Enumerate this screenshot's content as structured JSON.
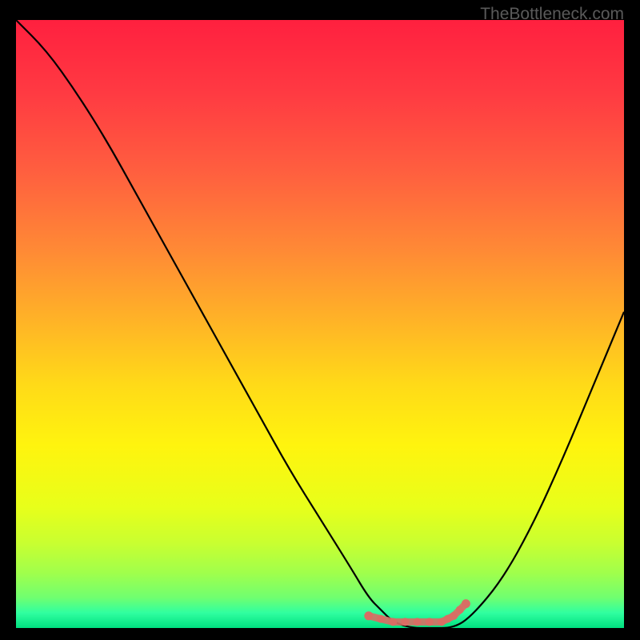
{
  "watermark": "TheBottleneck.com",
  "colors": {
    "black": "#000000",
    "curve": "#000000",
    "marker": "#d86e64"
  },
  "chart_data": {
    "type": "line",
    "title": "",
    "xlabel": "",
    "ylabel": "",
    "xlim": [
      0,
      100
    ],
    "ylim": [
      0,
      100
    ],
    "series": [
      {
        "name": "bottleneck-curve",
        "x": [
          0,
          5,
          10,
          15,
          20,
          25,
          30,
          35,
          40,
          45,
          50,
          55,
          58,
          60,
          62,
          65,
          68,
          72,
          75,
          80,
          85,
          90,
          95,
          100
        ],
        "y": [
          100,
          95,
          88,
          80,
          71,
          62,
          53,
          44,
          35,
          26,
          18,
          10,
          5,
          3,
          1,
          0,
          0,
          0,
          2,
          8,
          17,
          28,
          40,
          52
        ]
      }
    ],
    "markers": {
      "name": "optimal-range",
      "x": [
        58,
        60,
        62,
        64,
        66,
        68,
        70,
        71,
        72,
        73,
        74
      ],
      "y": [
        2,
        1.5,
        1,
        1,
        1,
        1,
        1,
        1.5,
        2,
        3,
        4
      ],
      "color": "#d86e64"
    },
    "gradient_stops": [
      {
        "offset": 0.0,
        "color": "#ff203f"
      },
      {
        "offset": 0.12,
        "color": "#ff3a42"
      },
      {
        "offset": 0.25,
        "color": "#ff5f3f"
      },
      {
        "offset": 0.38,
        "color": "#ff8a35"
      },
      {
        "offset": 0.5,
        "color": "#ffb526"
      },
      {
        "offset": 0.6,
        "color": "#ffda18"
      },
      {
        "offset": 0.7,
        "color": "#fff40e"
      },
      {
        "offset": 0.8,
        "color": "#e8ff1a"
      },
      {
        "offset": 0.86,
        "color": "#c9ff30"
      },
      {
        "offset": 0.91,
        "color": "#a0ff4c"
      },
      {
        "offset": 0.95,
        "color": "#70ff70"
      },
      {
        "offset": 0.975,
        "color": "#30ffa0"
      },
      {
        "offset": 1.0,
        "color": "#00e080"
      }
    ]
  }
}
